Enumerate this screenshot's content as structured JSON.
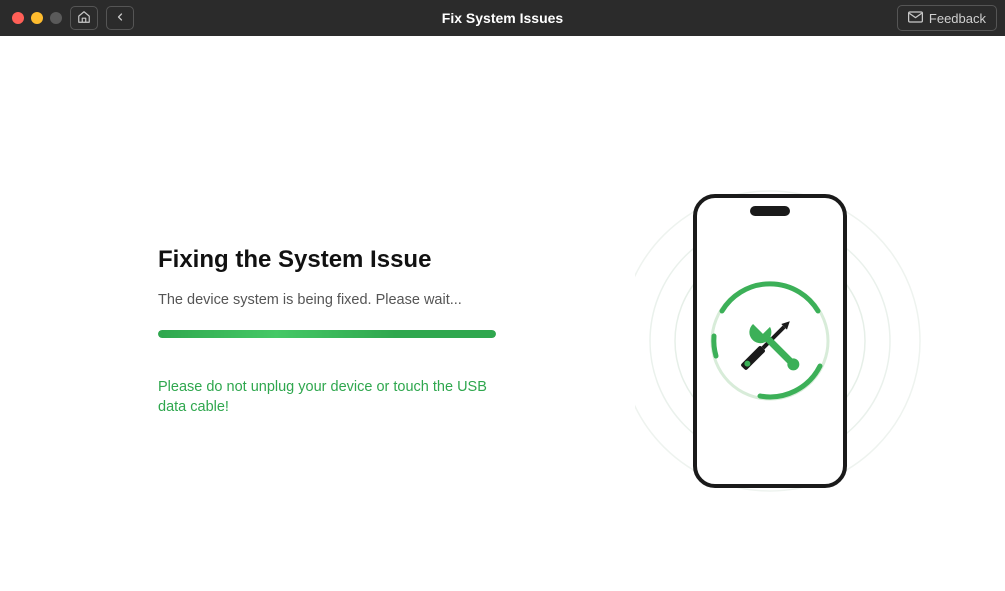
{
  "titlebar": {
    "title": "Fix System Issues",
    "feedback_label": "Feedback"
  },
  "main": {
    "heading": "Fixing the System Issue",
    "subtext": "The device system is being fixed. Please wait...",
    "warning": "Please do not unplug your device or touch the USB data cable!",
    "progress_percent": 100
  },
  "colors": {
    "accent": "#2fa74e",
    "titlebar_bg": "#2b2b2b"
  },
  "icons": {
    "home": "home-icon",
    "back": "chevron-left-icon",
    "mail": "mail-icon",
    "tools": "screwdriver-wrench-icon"
  }
}
